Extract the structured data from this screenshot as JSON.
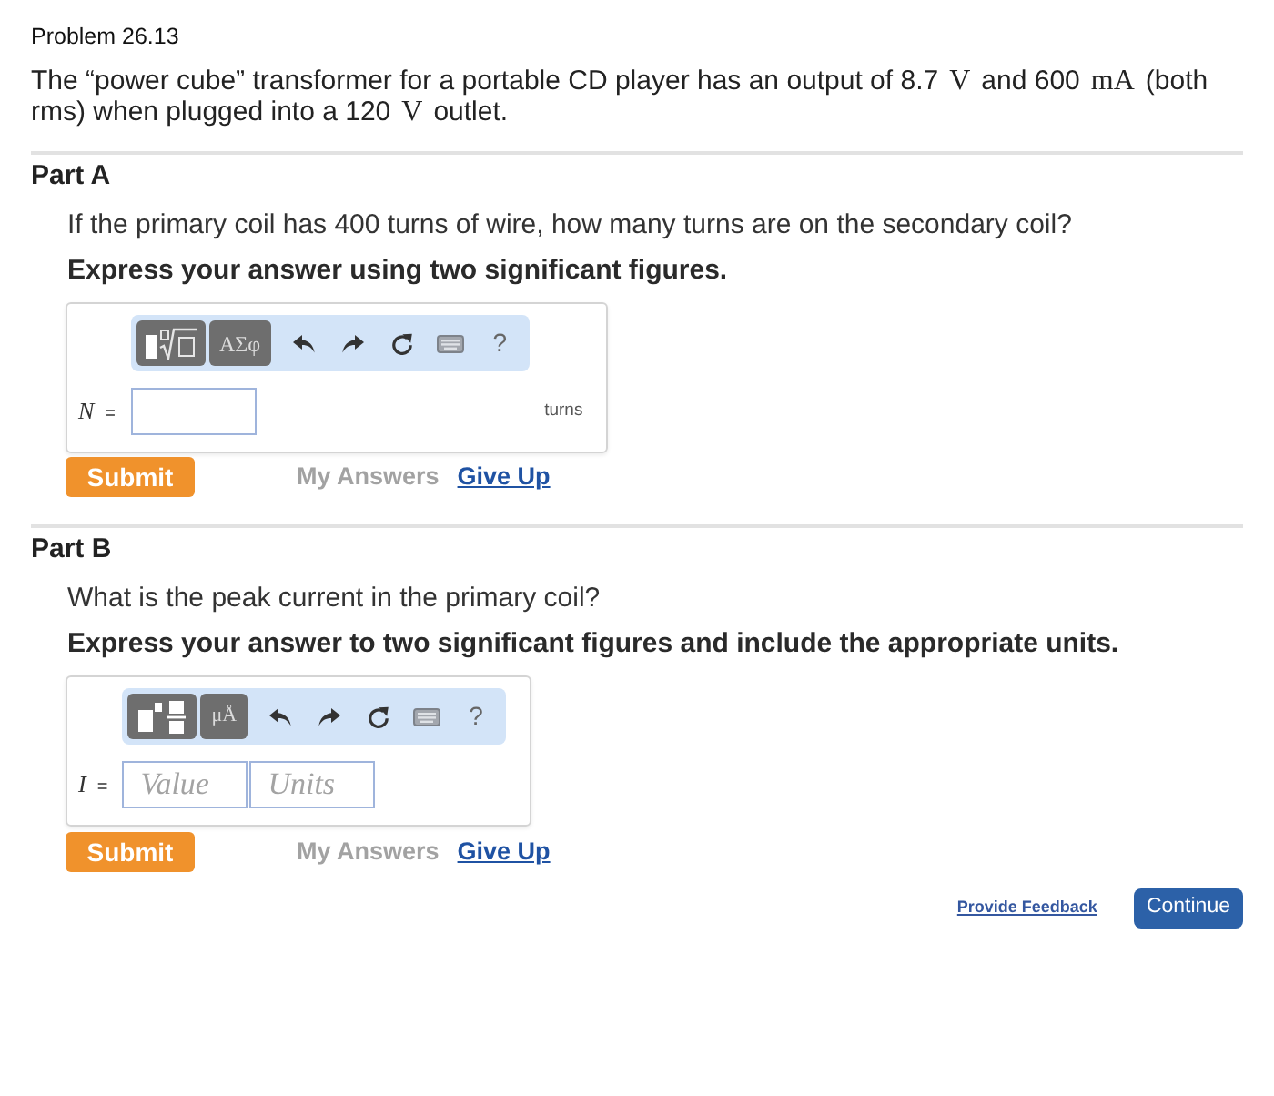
{
  "problem": {
    "title": "Problem 26.13",
    "statement": [
      {
        "kind": "text",
        "text": "The “power cube” transformer for a portable CD player has an output of 8.7"
      },
      {
        "kind": "math",
        "text": "V"
      },
      {
        "kind": "text",
        "text": "and 600"
      },
      {
        "kind": "math",
        "text": "mA"
      },
      {
        "kind": "text",
        "text": "(both rms) when plugged into a 120"
      },
      {
        "kind": "math",
        "text": "V"
      },
      {
        "kind": "text",
        "text": "outlet."
      }
    ]
  },
  "parts": [
    {
      "title": "Part A",
      "question": "If the primary coil has 400 turns of wire, how many turns are on the secondary coil?",
      "instruction": "Express your answer using two significant figures.",
      "toolbar": [
        {
          "kind": "root-template"
        },
        {
          "kind": "symbols",
          "label": "ΑΣφ"
        },
        {
          "kind": "undo"
        },
        {
          "kind": "redo"
        },
        {
          "kind": "reset"
        },
        {
          "kind": "keyboard"
        },
        {
          "kind": "help",
          "label": "?"
        }
      ],
      "answer": {
        "variable": "N",
        "relation": "=",
        "unit": "turns"
      },
      "actions": {
        "submit": "Submit",
        "my_answers": "My Answers",
        "give_up": "Give Up"
      }
    },
    {
      "title": "Part B",
      "question": "What is the peak current in the primary coil?",
      "instruction": "Express your answer to two significant figures and include the appropriate units.",
      "toolbar": [
        {
          "kind": "fraction-template"
        },
        {
          "kind": "units",
          "label": "μÅ"
        },
        {
          "kind": "undo"
        },
        {
          "kind": "redo"
        },
        {
          "kind": "reset"
        },
        {
          "kind": "keyboard"
        },
        {
          "kind": "help",
          "label": "?"
        }
      ],
      "answer": {
        "variable": "I",
        "relation": "=",
        "placeholders": [
          "Value",
          "Units"
        ]
      },
      "actions": {
        "submit": "Submit",
        "my_answers": "My Answers",
        "give_up": "Give Up"
      }
    }
  ],
  "footer": {
    "feedback_link": "Provide Feedback",
    "continue_button": "Continue"
  }
}
